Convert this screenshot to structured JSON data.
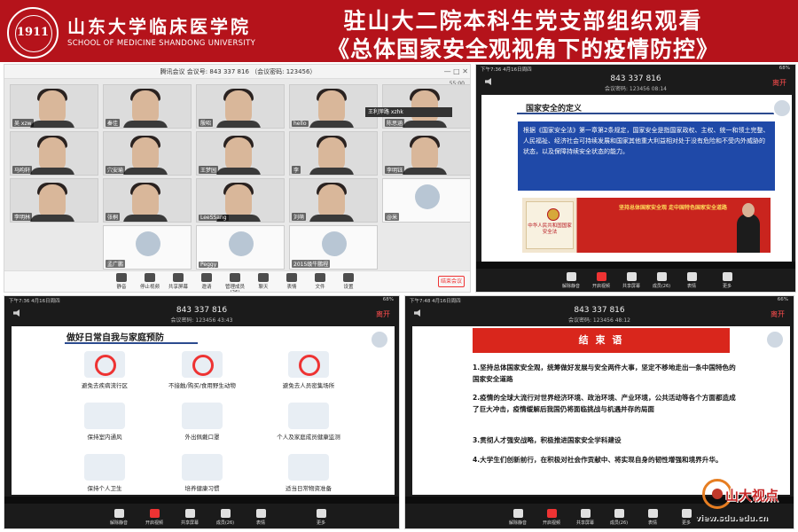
{
  "banner": {
    "logo_text": "1911",
    "school_cn": "山东大学临床医学院",
    "school_en": "SCHOOL OF MEDICINE SHANDONG UNIVERSITY",
    "title_line1": "驻山大二院本科生党支部组织观看",
    "title_line2": "《总体国家安全观视角下的疫情防控》",
    "bg_color": "#b5131b"
  },
  "panel1": {
    "window_title": "腾讯会议 会议号: 843 337 816 （会议密码: 123456）",
    "window_controls": "— □ ✕",
    "top_right": "55:00",
    "tooltip": "王利萍路 xzhk",
    "tiles": [
      {
        "name": "吴 xzw"
      },
      {
        "name": "秦佳"
      },
      {
        "name": "殷昭"
      },
      {
        "name": "hello"
      },
      {
        "name": "陈思涵"
      },
      {
        "name": "马昀轩"
      },
      {
        "name": "穴安瑜"
      },
      {
        "name": "王梦园"
      },
      {
        "name": "李"
      },
      {
        "name": "李明钰"
      },
      {
        "name": "李明林"
      },
      {
        "name": "张桐"
      },
      {
        "name": "LeeSSang"
      },
      {
        "name": "刘萌"
      },
      {
        "name": "@米"
      },
      {
        "name": "孟广鹏"
      },
      {
        "name": "Peggy"
      },
      {
        "name": "2015级牛鹏程"
      }
    ],
    "toolbar": [
      {
        "label": "静音"
      },
      {
        "label": "停止视频"
      },
      {
        "label": "共享屏幕"
      },
      {
        "label": "邀请"
      },
      {
        "label": "管理成员(26)"
      },
      {
        "label": "聊天"
      },
      {
        "label": "表情"
      },
      {
        "label": "文件"
      },
      {
        "label": "设置"
      }
    ],
    "leave": "结束会议"
  },
  "panel2": {
    "status_left": "下午7:36  4月16日周四",
    "status_right": "68%",
    "meeting_id": "843 337 816",
    "meeting_sub": "会议密码: 123456  08:14",
    "leave": "离开",
    "slide_title": "国家安全的定义",
    "slide_body": "根据《国家安全法》第一章第2条规定，国家安全是指国家政权、主权、统一和领土完整、人民福祉、经济社会可持续发展和国家其他重大利益相对处于没有危险和不受内外威胁的状态，以及保障持续安全状态的能力。",
    "book_text": "中华人民共和国国家安全法",
    "banner_text": "坚持总体国家安全观 走中国特色国家安全道路",
    "toolbar": [
      {
        "label": "解除静音"
      },
      {
        "label": "开启视频"
      },
      {
        "label": "共享屏幕"
      },
      {
        "label": "成员(26)"
      },
      {
        "label": "表情"
      },
      {
        "label": "更多"
      }
    ]
  },
  "panel3": {
    "status_left": "下午7:36  4月16日周四",
    "status_right": "68%",
    "meeting_id": "843 337 816",
    "meeting_sub": "会议密码: 123456  43:43",
    "leave": "离开",
    "slide_title": "做好日常自我与家庭预防",
    "items": [
      {
        "label": "避免去疾病流行区"
      },
      {
        "label": "不接触/购买/食用野生动物"
      },
      {
        "label": "避免去人员密集场所"
      },
      {
        "label": "保持室内通风"
      },
      {
        "label": "外出佩戴口罩"
      },
      {
        "label": "个人及家庭成员健康监测"
      },
      {
        "label": "保持个人卫生"
      },
      {
        "label": "培养健康习惯"
      },
      {
        "label": "适当日常物资准备"
      }
    ],
    "toolbar": [
      {
        "label": "解除静音"
      },
      {
        "label": "开启视频"
      },
      {
        "label": "共享屏幕"
      },
      {
        "label": "成员(26)"
      },
      {
        "label": "表情"
      },
      {
        "label": "更多"
      }
    ]
  },
  "panel4": {
    "status_left": "下午7:48  4月16日周四",
    "status_right": "66%",
    "meeting_id": "843 337 816",
    "meeting_sub": "会议密码: 123456  48:12",
    "leave": "离开",
    "slide_title": "结 束 语",
    "paragraphs": [
      "1.坚持总体国家安全观，统筹做好发展与安全两件大事，坚定不移地走出一条中国特色的国家安全道路",
      "2.疫情的全球大流行对世界经济环境、政治环境、产业环境，公共活动等各个方面都造成了巨大冲击，疫情缓解后我国仍将面临挑战与机遇并存的局面",
      "3.贯彻人才强安战略，积极推进国家安全学科建设",
      "4.大学生们创新前行，在积极对社会作贡献中、将实现自身的韧性增强和境界升华。"
    ],
    "toolbar": [
      {
        "label": "解除静音"
      },
      {
        "label": "开启视频"
      },
      {
        "label": "共享屏幕"
      },
      {
        "label": "成员(26)"
      },
      {
        "label": "表情"
      },
      {
        "label": "更多"
      }
    ]
  },
  "watermark": {
    "brand": "山大视点",
    "url": "view.sdu.edu.cn"
  }
}
